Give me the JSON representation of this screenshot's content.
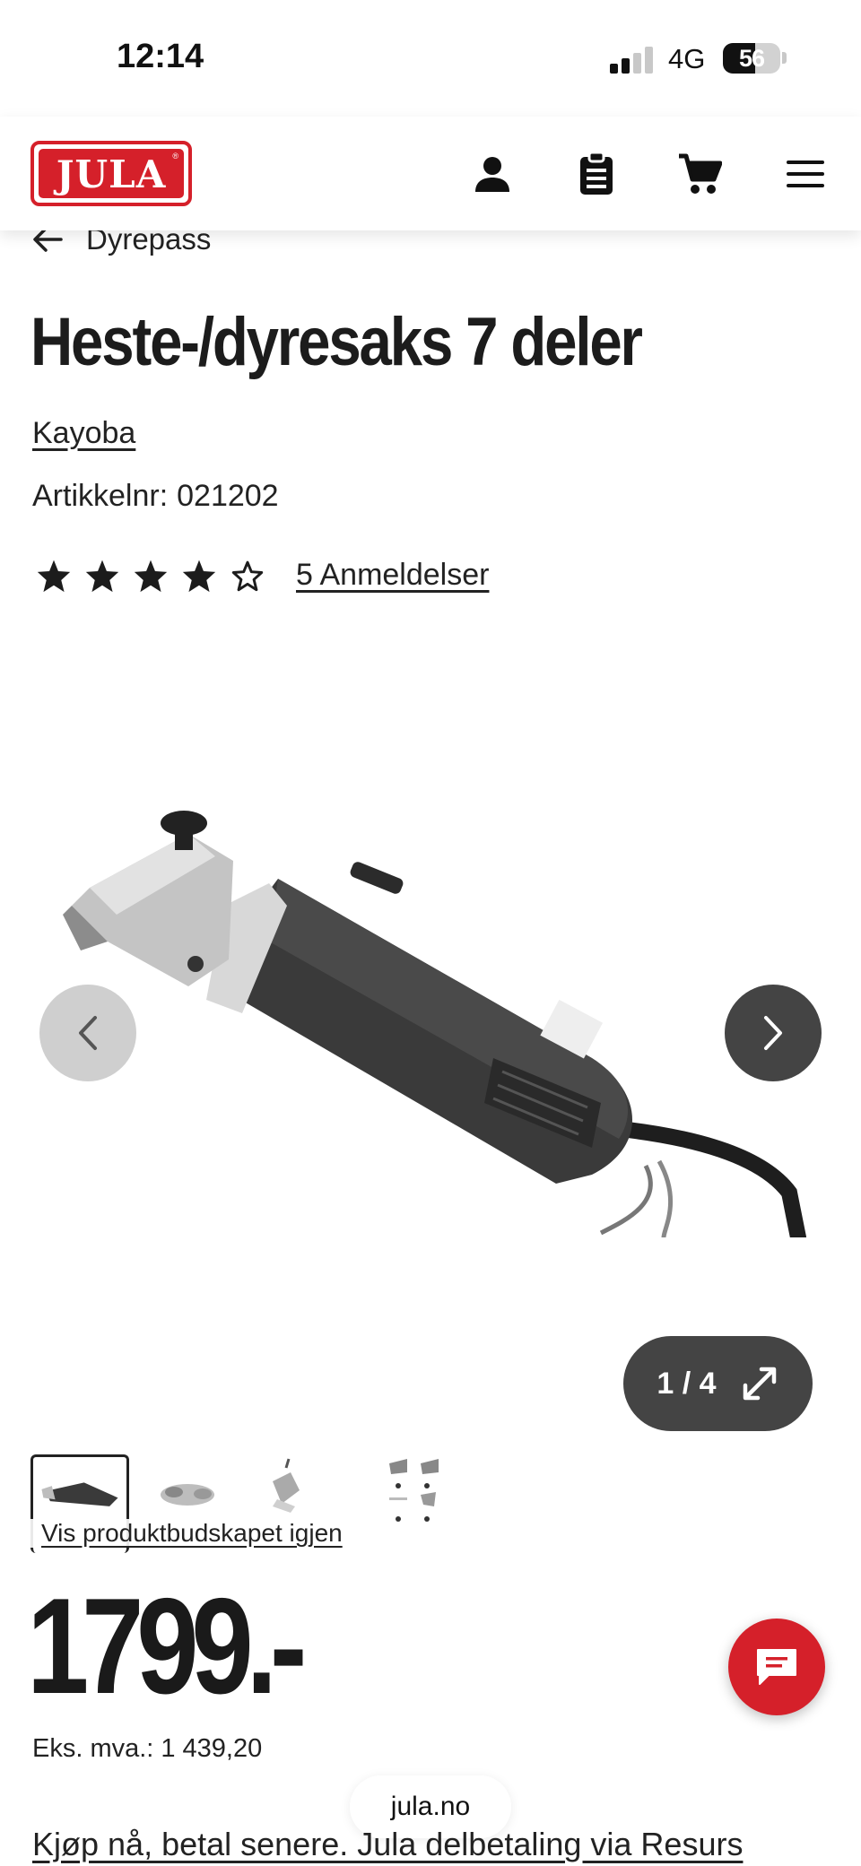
{
  "status_bar": {
    "time": "12:14",
    "network": "4G",
    "battery": "56",
    "battery_level": 0.56
  },
  "header": {
    "logo_text": "JULA",
    "icons": [
      "user-icon",
      "clipboard-list-icon",
      "shopping-cart-icon",
      "hamburger-menu-icon"
    ]
  },
  "breadcrumb": {
    "label": "Dyrepass"
  },
  "product": {
    "title": "Heste-/dyresaks 7 deler",
    "brand": "Kayoba",
    "article_label": "Artikkelnr:",
    "article_number": "021202",
    "rating": 4,
    "rating_max": 5,
    "reviews_link": "5 Anmeldelser"
  },
  "gallery": {
    "counter": "1 / 4",
    "current": 1,
    "total": 4,
    "restore_link": "Vis produktbudskapet igjen"
  },
  "pricing": {
    "price": "1799.-",
    "ex_vat_label": "Eks. mva.:",
    "ex_vat_value": "1 439,20"
  },
  "browser": {
    "domain": "jula.no"
  },
  "footer": {
    "financing_link": "Kjøp nå, betal senere. Jula delbetaling via Resurs"
  },
  "colors": {
    "brand_red": "#d5202a",
    "dark_button": "#444444",
    "light_button": "#cfcfcf"
  }
}
